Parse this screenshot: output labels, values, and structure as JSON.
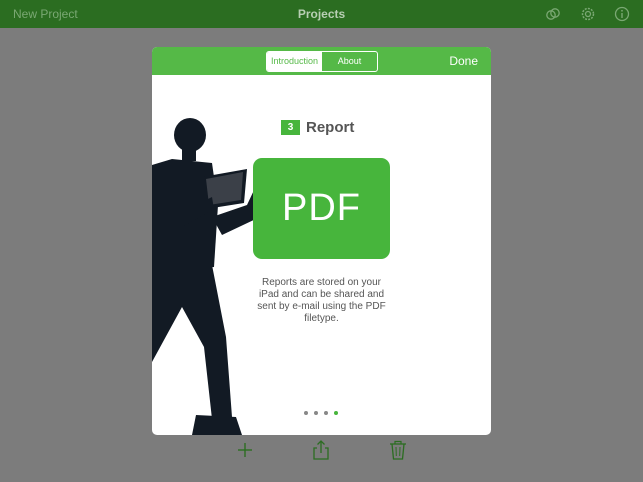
{
  "navbar": {
    "left_label": "New Project",
    "title": "Projects",
    "icons": [
      "link-icon",
      "gear-icon",
      "info-icon"
    ]
  },
  "modal": {
    "segments": [
      {
        "label": "Introduction",
        "active": true
      },
      {
        "label": "About",
        "active": false
      }
    ],
    "done_label": "Done",
    "step_number": "3",
    "heading": "Report",
    "tile_text": "PDF",
    "description": "Reports are stored on your iPad and can be shared and sent by e-mail using the PDF filetype.",
    "page_count": 4,
    "current_page": 4
  },
  "toolbar": {
    "icons": [
      "plus-icon",
      "share-icon",
      "trash-icon"
    ]
  },
  "colors": {
    "navbar": "#2b6d21",
    "accent": "#55b947",
    "tile": "#47b53c",
    "backdrop": "#7c7c7c"
  }
}
